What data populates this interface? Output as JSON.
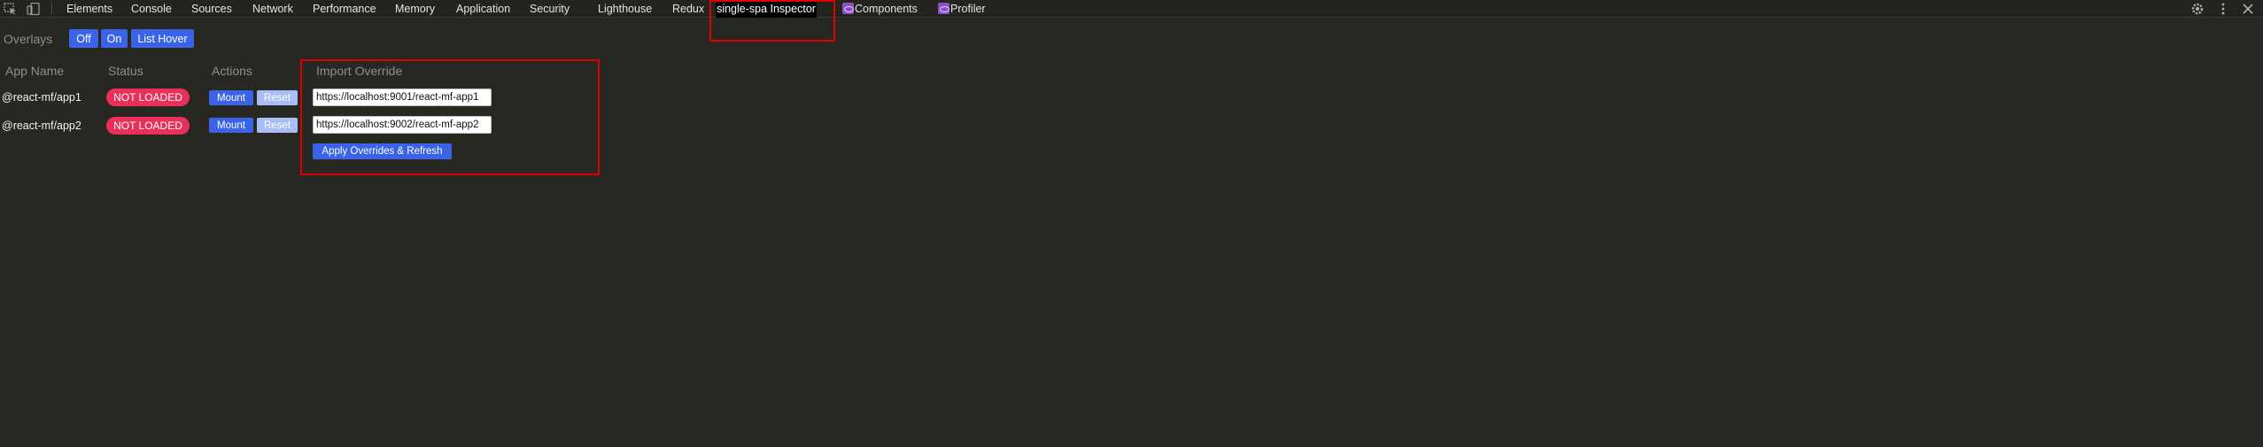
{
  "devtools": {
    "tabs": [
      "Elements",
      "Console",
      "Sources",
      "Network",
      "Performance",
      "Memory",
      "Application",
      "Security",
      "Lighthouse",
      "Redux",
      "single-spa Inspector",
      "Components",
      "Profiler"
    ],
    "active_tab": "single-spa Inspector",
    "toolbar_icons": [
      "inspect-element-icon",
      "device-toolbar-icon"
    ],
    "right_icons": [
      "gear-icon",
      "kebab-menu-icon",
      "close-icon"
    ]
  },
  "overlays": {
    "label": "Overlays",
    "buttons": [
      "Off",
      "On",
      "List Hover"
    ]
  },
  "table": {
    "headers": {
      "app_name": "App Name",
      "status": "Status",
      "actions": "Actions",
      "import_override": "Import Override"
    },
    "rows": [
      {
        "name": "@react-mf/app1",
        "status": "NOT LOADED",
        "mount_label": "Mount",
        "reset_label": "Reset",
        "override_url": "https://localhost:9001/react-mf-app1"
      },
      {
        "name": "@react-mf/app2",
        "status": "NOT LOADED",
        "mount_label": "Mount",
        "reset_label": "Reset",
        "override_url": "https://localhost:9002/react-mf-app2"
      }
    ],
    "apply_button": "Apply Overrides & Refresh"
  },
  "colors": {
    "background": "#272822",
    "accent_blue": "#3a63e8",
    "status_red": "#e8305a",
    "highlight_red": "#e00000"
  }
}
